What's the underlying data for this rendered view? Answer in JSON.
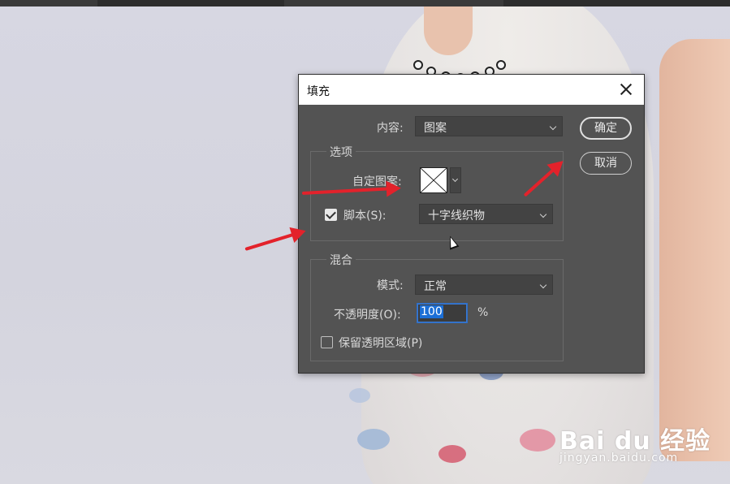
{
  "dialog": {
    "title": "填充",
    "content_label": "内容:",
    "content_value": "图案",
    "ok_label": "确定",
    "cancel_label": "取消",
    "options": {
      "group_title": "选项",
      "custom_pattern_label": "自定图案:",
      "script_label": "脚本(S):",
      "script_checked": true,
      "script_value": "十字线织物"
    },
    "blending": {
      "group_title": "混合",
      "mode_label": "模式:",
      "mode_value": "正常",
      "opacity_label": "不透明度(O):",
      "opacity_value": "100",
      "opacity_unit": "%",
      "preserve_label": "保留透明区域(P)",
      "preserve_checked": false
    }
  },
  "watermark": {
    "logo": "Bai du 经验",
    "url": "jingyan.baidu.com"
  },
  "colors": {
    "dialog_bg": "#535353",
    "arrow": "#e3222b",
    "selection": "#1c6fd6"
  }
}
